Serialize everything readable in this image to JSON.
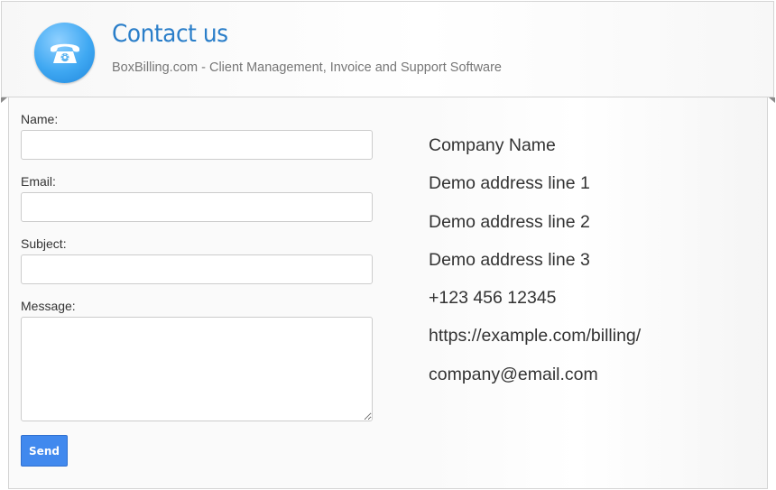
{
  "header": {
    "title": "Contact us",
    "subtitle": "BoxBilling.com - Client Management, Invoice and Support Software",
    "icon": "telephone-icon"
  },
  "form": {
    "name_label": "Name:",
    "name_value": "",
    "email_label": "Email:",
    "email_value": "",
    "subject_label": "Subject:",
    "subject_value": "",
    "message_label": "Message:",
    "message_value": "",
    "send_label": "Send"
  },
  "contact": {
    "company_name": "Company Name",
    "address_line_1": "Demo address line 1",
    "address_line_2": "Demo address line 2",
    "address_line_3": "Demo address line 3",
    "phone": "+123 456 12345",
    "website": "https://example.com/billing/",
    "email": "company@email.com"
  },
  "colors": {
    "title": "#2a7ec9",
    "button": "#4189ee",
    "icon_badge": "#3fa8f2"
  }
}
